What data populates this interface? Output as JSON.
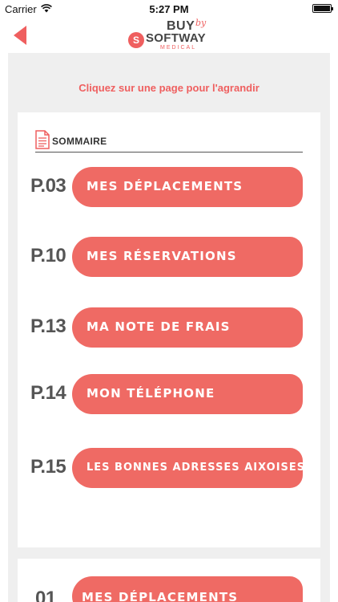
{
  "status_bar": {
    "carrier": "Carrier",
    "time": "5:27 PM"
  },
  "header": {
    "logo": {
      "buy": "BUY",
      "by": "by",
      "badge": "S",
      "softway": "SOFTWAY",
      "medical": "MEDICAL"
    }
  },
  "hint": "Cliquez sur une page pour l'agrandir",
  "sommaire": {
    "label": "SOMMAIRE"
  },
  "toc": [
    {
      "page": "P.03",
      "label": "MES DÉPLACEMENTS"
    },
    {
      "page": "P.10",
      "label": "MES RÉSERVATIONS"
    },
    {
      "page": "P.13",
      "label": "MA NOTE DE FRAIS"
    },
    {
      "page": "P.14",
      "label": "MON TÉLÉPHONE"
    },
    {
      "page": "P.15",
      "label": "LES BONNES ADRESSES AIXOISES"
    }
  ],
  "next_card": {
    "page": "01",
    "label": "MES DÉPLACEMENTS"
  },
  "colors": {
    "accent": "#ef6a64",
    "hint": "#ef5f5f",
    "background": "#efefef"
  }
}
